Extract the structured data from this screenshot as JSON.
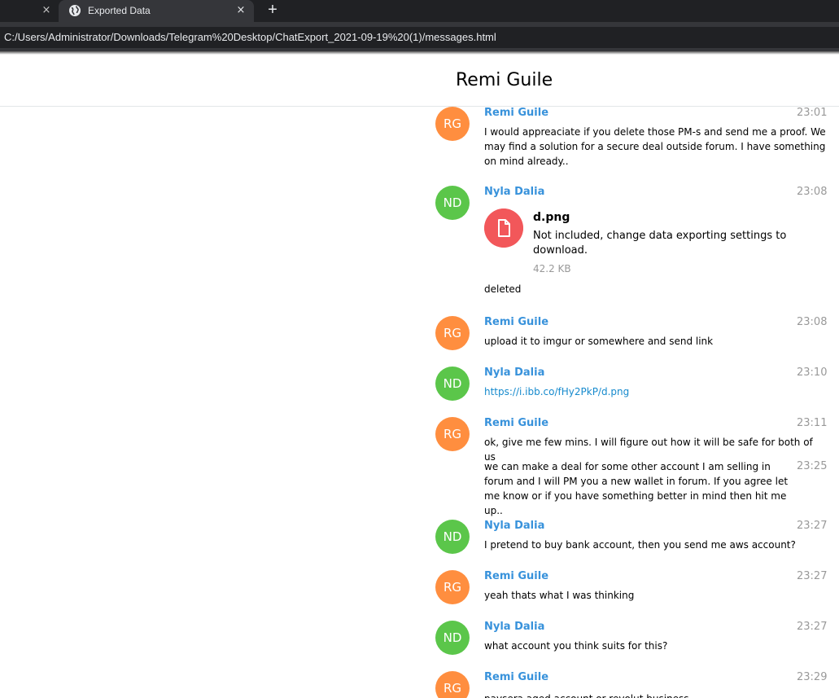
{
  "browser": {
    "inactive_tab_close": "×",
    "active_tab": {
      "title": "Exported Data",
      "close": "×"
    },
    "new_tab": "+",
    "url": "C:/Users/Administrator/Downloads/Telegram%20Desktop/ChatExport_2021-09-19%20(1)/messages.html"
  },
  "page": {
    "title": "Remi Guile"
  },
  "colors": {
    "orange_avatar": "#ff8e3f",
    "green_avatar": "#5bc64a",
    "name": "#3892db",
    "file_icon": "#f2575a"
  },
  "messages": [
    {
      "initials": "RG",
      "from": "Remi Guile",
      "time": "23:01",
      "text": "I would appreaciate if you delete those PM-s and send me a proof. We may find a solution for a secure deal outside forum. I have something on mind already.."
    },
    {
      "initials": "ND",
      "from": "Nyla Dalia",
      "time": "23:08",
      "file": {
        "name": "d.png",
        "status": "Not included, change data exporting settings to download.",
        "size": "42.2 KB",
        "icon": "document-icon"
      },
      "text": "deleted"
    },
    {
      "initials": "RG",
      "from": "Remi Guile",
      "time": "23:08",
      "text": "upload it to imgur or somewhere and send link"
    },
    {
      "initials": "ND",
      "from": "Nyla Dalia",
      "time": "23:10",
      "link": "https://i.ibb.co/fHy2PkP/d.png"
    },
    {
      "initials": "RG",
      "from": "Remi Guile",
      "time": "23:11",
      "text": "ok, give me few mins. I will figure out how it will be safe for both of us"
    },
    {
      "time": "23:25",
      "text": "we can make a deal for some other account I am selling in forum and I will PM you a new wallet in forum. If you agree let me know or if you have something better in mind then hit me up.."
    },
    {
      "initials": "ND",
      "from": "Nyla Dalia",
      "time": "23:27",
      "text": "I pretend to buy bank account, then you send me aws account?"
    },
    {
      "initials": "RG",
      "from": "Remi Guile",
      "time": "23:27",
      "text": "yeah thats what I was thinking"
    },
    {
      "initials": "ND",
      "from": "Nyla Dalia",
      "time": "23:27",
      "text": "what account you think suits for this?"
    },
    {
      "initials": "RG",
      "from": "Remi Guile",
      "time": "23:29",
      "text": "paysera aged account or revolut business"
    }
  ]
}
